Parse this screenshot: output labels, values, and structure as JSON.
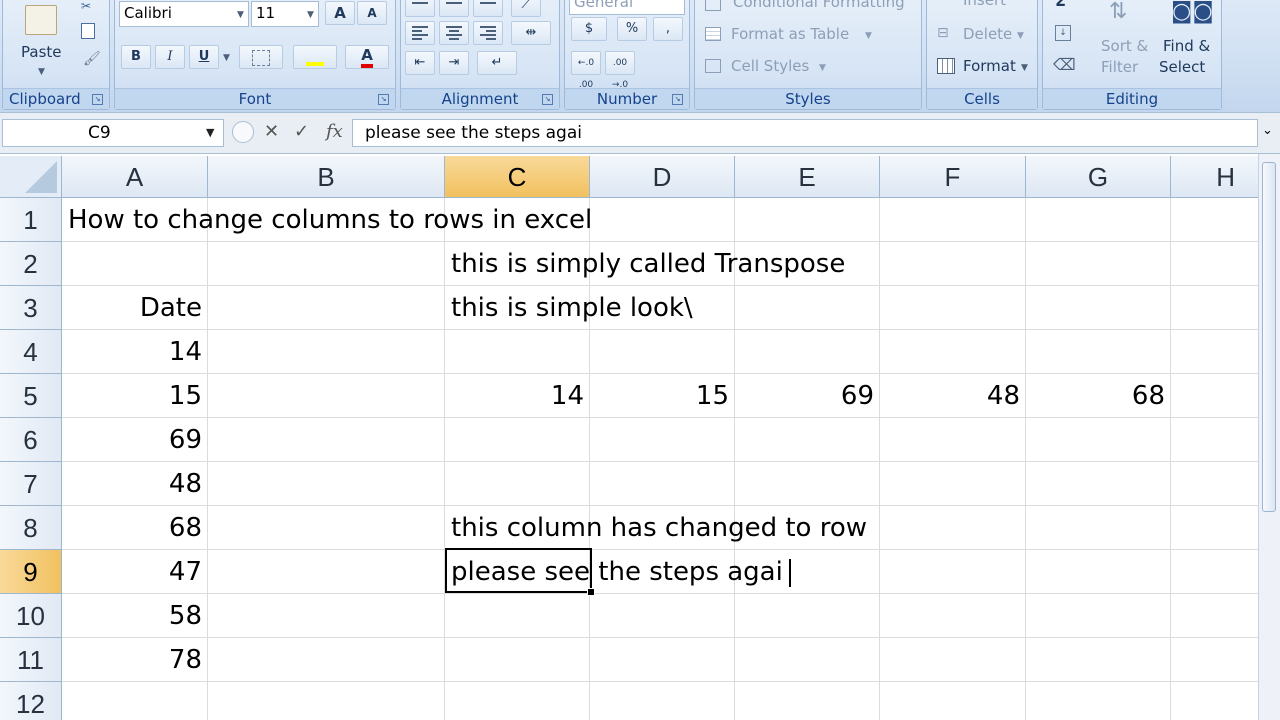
{
  "ribbon": {
    "clipboard": {
      "label": "Clipboard",
      "paste": "Paste"
    },
    "font": {
      "label": "Font",
      "name": "Calibri",
      "size": "11",
      "bold": "B",
      "italic": "I",
      "underline": "U",
      "grow": "A",
      "shrink": "A",
      "font_color": "A"
    },
    "alignment": {
      "label": "Alignment"
    },
    "number": {
      "label": "Number",
      "format": "General",
      "currency": "$",
      "percent": "%",
      "comma": ",",
      "inc_decimal": "←.0 .00",
      "dec_decimal": ".00 →.0"
    },
    "styles": {
      "label": "Styles",
      "conditional": "Conditional Formatting",
      "format_table": "Format as Table",
      "cell_styles": "Cell Styles"
    },
    "cells": {
      "label": "Cells",
      "insert": "Insert",
      "delete": "Delete",
      "format": "Format"
    },
    "editing": {
      "label": "Editing",
      "sort_1": "Sort &",
      "sort_2": "Filter",
      "find_1": "Find &",
      "find_2": "Select"
    }
  },
  "formula_bar": {
    "name_box": "C9",
    "content": "please see the steps agai"
  },
  "columns": [
    "A",
    "B",
    "C",
    "D",
    "E",
    "F",
    "G",
    "H"
  ],
  "rows": [
    "1",
    "2",
    "3",
    "4",
    "5",
    "6",
    "7",
    "8",
    "9",
    "10",
    "11",
    "12"
  ],
  "cells": {
    "A1": "How to change columns to rows in excel",
    "C2": "this is simply called Transpose",
    "A3": "Date",
    "C3": "this is simple look\\",
    "A4": "14",
    "A5": "15",
    "C5": "14",
    "D5": "15",
    "E5": "69",
    "F5": "48",
    "G5": "68",
    "A6": "69",
    "A7": "48",
    "A8": "68",
    "C8": "this column has changed to row",
    "A9": "47",
    "C9": "please see the steps agai",
    "A10": "58",
    "A11": "78"
  },
  "active": {
    "column": "C",
    "row": "9"
  }
}
